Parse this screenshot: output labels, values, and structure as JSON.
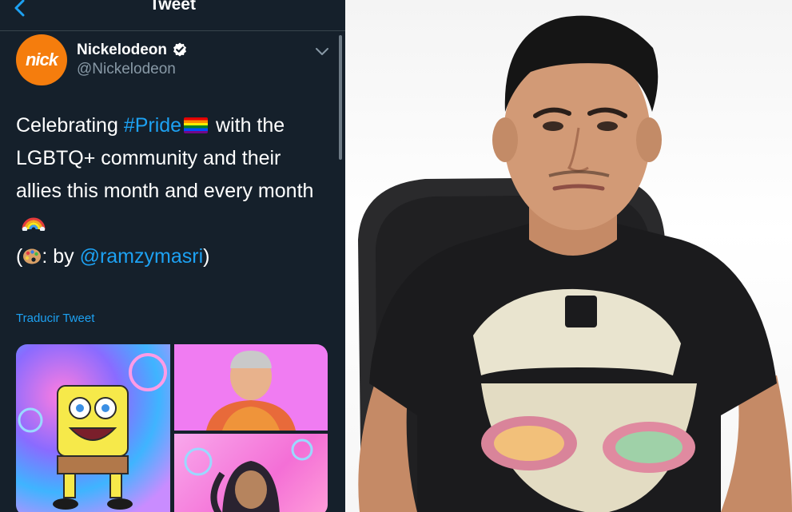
{
  "header": {
    "title": "Tweet"
  },
  "account": {
    "avatar_text": "nick",
    "display_name": "Nickelodeon",
    "handle": "@Nickelodeon",
    "verified": true
  },
  "tweet": {
    "text_part1": "Celebrating ",
    "hashtag": "#Pride",
    "text_part2": " with the LGBTQ+ community and their allies this month and every month",
    "credit_prefix": "(",
    "credit_by": ": by ",
    "mention": "@ramzymasri",
    "credit_suffix": ")",
    "translate_label": "Traducir Tweet"
  },
  "icons": {
    "back": "chevron-left-icon",
    "verified": "verified-badge-icon",
    "menu": "chevron-down-icon",
    "pride": "pride-flag-icon",
    "rainbow": "rainbow-icon",
    "palette": "artist-palette-icon"
  },
  "colors": {
    "background": "#15202b",
    "accent": "#1da1f2",
    "secondary_text": "#8899a6",
    "avatar": "#f57d0d"
  }
}
